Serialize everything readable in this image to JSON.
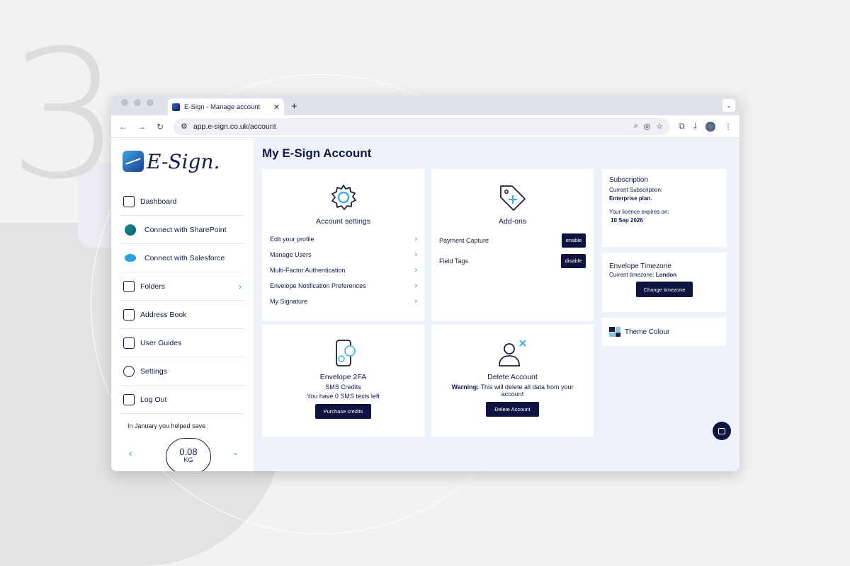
{
  "background": {
    "step_number": "3"
  },
  "browser": {
    "tab_title": "E-Sign - Manage account",
    "url": "app.e-sign.co.uk/account",
    "icons": {
      "back": "back-arrow-icon",
      "forward": "forward-arrow-icon",
      "reload": "reload-icon",
      "site_info": "site-settings-icon",
      "zoom": "zoom-icon",
      "eye": "eye-off-icon",
      "star": "bookmark-star-icon",
      "extensions": "extensions-icon",
      "download": "download-icon",
      "menu": "more-vert-icon"
    }
  },
  "logo": {
    "text": "E-Sign."
  },
  "sidebar": {
    "items": [
      {
        "label": "Dashboard",
        "icon": "dashboard-icon"
      },
      {
        "label": "Connect with SharePoint",
        "icon": "sharepoint-icon"
      },
      {
        "label": "Connect with Salesforce",
        "icon": "salesforce-icon"
      },
      {
        "label": "Folders",
        "icon": "folder-icon"
      },
      {
        "label": "Address Book",
        "icon": "address-book-icon"
      },
      {
        "label": "User Guides",
        "icon": "book-icon"
      },
      {
        "label": "Settings",
        "icon": "gear-icon"
      },
      {
        "label": "Log Out",
        "icon": "logout-icon"
      }
    ],
    "carbon": {
      "text": "In January you helped save",
      "value": "0.08",
      "unit": "KG"
    }
  },
  "main": {
    "title": "My E-Sign Account",
    "account_settings": {
      "title": "Account settings",
      "items": [
        "Edit your profile",
        "Manage Users",
        "Multi-Factor Authentication",
        "Envelope Notification Preferences",
        "My Signature"
      ]
    },
    "addons": {
      "title": "Add-ons",
      "items": [
        {
          "label": "Payment Capture",
          "button": "enable"
        },
        {
          "label": "Field Tags",
          "button": "disable"
        }
      ]
    },
    "envelope_2fa": {
      "title": "Envelope 2FA",
      "line1": "SMS Credits",
      "line2": "You have 0 SMS texts left",
      "button": "Purchase credits"
    },
    "delete_account": {
      "title": "Delete Account",
      "warning_label": "Warning:",
      "warning_text": "This will delete all data from your account",
      "button": "Delete Account"
    },
    "subscription": {
      "title": "Subscription",
      "current_label": "Current Subscription:",
      "plan": "Enterprise plan.",
      "expires_label": "Your licence expires on:",
      "expires_date": "10 Sep 2026"
    },
    "timezone": {
      "title": "Envelope Timezone",
      "current_label": "Current timezone:",
      "current_value": "London",
      "button": "Change timezone"
    },
    "theme": {
      "title": "Theme Colour"
    }
  }
}
